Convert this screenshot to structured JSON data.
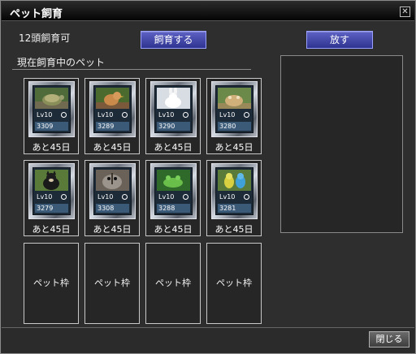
{
  "window": {
    "title": "ペット飼育",
    "close_icon": "close-icon"
  },
  "header": {
    "capacity": "12頭飼育可",
    "breed_label": "飼育する",
    "release_label": "放す"
  },
  "section": {
    "label": "現在飼育中のペット"
  },
  "pets": [
    {
      "level": "Lv10",
      "id": "3309",
      "days": "あと45日",
      "picture": "turtle"
    },
    {
      "level": "Lv10",
      "id": "3289",
      "days": "あと45日",
      "picture": "chick"
    },
    {
      "level": "Lv10",
      "id": "3290",
      "days": "あと45日",
      "picture": "rabbit"
    },
    {
      "level": "Lv10",
      "id": "3280",
      "days": "あと45日",
      "picture": "hamster"
    },
    {
      "level": "Lv10",
      "id": "3279",
      "days": "あと45日",
      "picture": "dog"
    },
    {
      "level": "Lv10",
      "id": "3308",
      "days": "あと45日",
      "picture": "sugar-glider"
    },
    {
      "level": "Lv10",
      "id": "3288",
      "days": "あと45日",
      "picture": "frog"
    },
    {
      "level": "Lv10",
      "id": "3281",
      "days": "あと45日",
      "picture": "parakeets"
    }
  ],
  "empty_slots": [
    {
      "label": "ペット枠"
    },
    {
      "label": "ペット枠"
    },
    {
      "label": "ペット枠"
    },
    {
      "label": "ペット枠"
    }
  ],
  "footer": {
    "close_label": "閉じる"
  }
}
